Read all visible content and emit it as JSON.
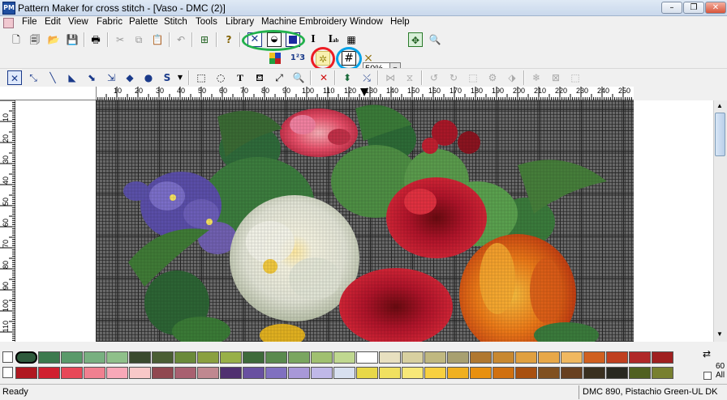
{
  "window": {
    "title": "Pattern Maker for cross stitch - [Vaso - DMC (2)]",
    "icon": "PM"
  },
  "menu": [
    "File",
    "Edit",
    "View",
    "Fabric",
    "Palette",
    "Stitch",
    "Tools",
    "Library",
    "Machine Embroidery",
    "Window",
    "Help"
  ],
  "toolbar": {
    "zoom": "50%",
    "text_tool": "I",
    "text_tool2": "I",
    "text_tool2_sub": "ab",
    "numbers_label": "1²3"
  },
  "highlight_colors": {
    "green": "#22b14c",
    "red": "#ed1c24",
    "blue": "#00a2e8"
  },
  "ruler": {
    "horizontal": [
      "10",
      "20",
      "30",
      "40",
      "50",
      "60",
      "70",
      "80",
      "90",
      "100",
      "110",
      "120",
      "130",
      "140",
      "150",
      "160",
      "170",
      "180",
      "190",
      "200",
      "210",
      "220",
      "230",
      "240",
      "250"
    ],
    "vertical": [
      "10",
      "20",
      "30",
      "40",
      "50",
      "60",
      "70",
      "80",
      "90",
      "100",
      "110"
    ]
  },
  "palette": {
    "row1": [
      "#2e5a3c",
      "#3c7a4e",
      "#5a9a6a",
      "#78b080",
      "#8fc08a",
      "#3a4a2e",
      "#4a5e34",
      "#6a8a3a",
      "#8aa040",
      "#98b048",
      "#3e6a3a",
      "#5a8a4e",
      "#7aa660",
      "#a0c070",
      "#c0d890",
      "#ffffff",
      "#e8e0c0",
      "#d8d0a0",
      "#c0b880",
      "#a8a070",
      "#b07830",
      "#c88830",
      "#e0a040",
      "#e8a848",
      "#f0b860",
      "#d06020",
      "#c04020",
      "#b02828",
      "#a02020"
    ],
    "row2": [
      "#b01820",
      "#d02030",
      "#e84858",
      "#f08090",
      "#f8a8b8",
      "#f8c8c8",
      "#904850",
      "#a86070",
      "#c08890",
      "#503070",
      "#6850a0",
      "#8070c0",
      "#a898d8",
      "#c0b8e8",
      "#d8e0f0",
      "#e8d848",
      "#f0e060",
      "#f8e878",
      "#f8d040",
      "#f0b020",
      "#e89010",
      "#d07010",
      "#a85010",
      "#805020",
      "#684020",
      "#3a3020",
      "#282820",
      "#506020",
      "#788030"
    ],
    "selected_label": "60",
    "all_label": "All",
    "arrows": "⇄"
  },
  "status": {
    "left": "Ready",
    "color": "DMC  890, Pistachio Green-UL DK"
  }
}
